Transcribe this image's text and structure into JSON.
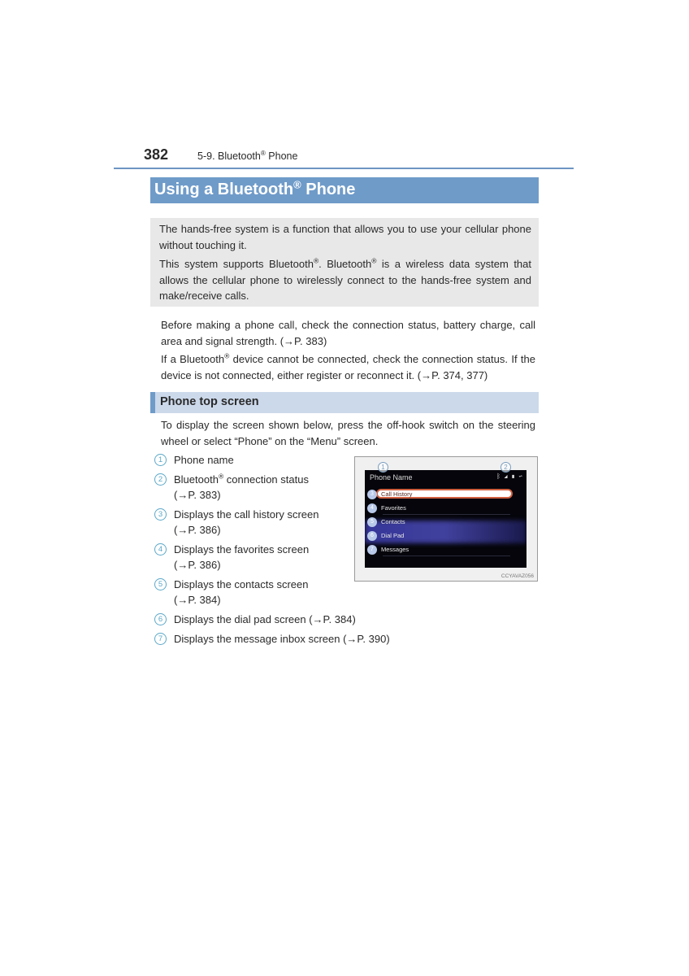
{
  "header": {
    "page_number": "382",
    "section_prefix": "5-9. Bluetooth",
    "section_reg": "®",
    "section_suffix": " Phone"
  },
  "title": {
    "prefix": "Using a Bluetooth",
    "reg": "®",
    "suffix": " Phone"
  },
  "intro": {
    "p1": "The hands-free system is a function that allows you to use your cellular phone without touching it.",
    "p2_a": "This system supports Bluetooth",
    "p2_b": ". Bluetooth",
    "p2_c": " is a wireless data system that allows the cellular phone to wirelessly connect to the hands-free system and make/receive calls.",
    "reg": "®"
  },
  "body": {
    "p1": "Before making a phone call, check the connection status, battery charge, call area and signal strength. (→P. 383)",
    "p2_a": "If a Bluetooth",
    "p2_b": " device cannot be connected, check the connection status. If the device is not connected, either register or reconnect it. (→P. 374, 377)",
    "reg": "®"
  },
  "subsection": {
    "title": "Phone top screen",
    "intro": "To display the screen shown below, press the off-hook switch on the steering wheel or select “Phone” on the “Menu” screen."
  },
  "legend": [
    {
      "num": "1",
      "line1": "Phone name",
      "line2": ""
    },
    {
      "num": "2",
      "line1_a": "Bluetooth",
      "reg": "®",
      "line1_b": " connection status",
      "line2": "(→P. 383)"
    },
    {
      "num": "3",
      "line1": "Displays the call history screen",
      "line2": "(→P. 386)"
    },
    {
      "num": "4",
      "line1": "Displays the favorites screen",
      "line2": "(→P. 386)"
    },
    {
      "num": "5",
      "line1": "Displays the contacts screen",
      "line2": "(→P. 384)"
    },
    {
      "num": "6",
      "line1": "Displays the dial pad screen (→P. 384)",
      "line2": ""
    },
    {
      "num": "7",
      "line1": "Displays the message inbox screen (→P. 390)",
      "line2": ""
    }
  ],
  "screen": {
    "phone_name": "Phone Name",
    "status_icons": "ᛒ ◢ ▮ ↩",
    "menu": [
      {
        "num": "3",
        "label": "Call History",
        "selected": true
      },
      {
        "num": "4",
        "label": "Favorites",
        "selected": false
      },
      {
        "num": "5",
        "label": "Contacts",
        "selected": false
      },
      {
        "num": "6",
        "label": "Dial Pad",
        "selected": false
      },
      {
        "num": "7",
        "label": "Messages",
        "selected": false
      }
    ],
    "callout_1": "1",
    "callout_2": "2",
    "image_code": "CCYAVAZ056"
  }
}
